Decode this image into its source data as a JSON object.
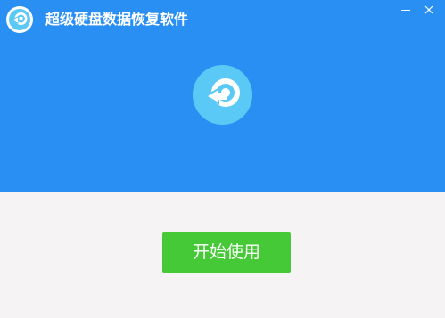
{
  "window": {
    "title": "超级硬盘数据恢复软件",
    "icon": "data-recovery-icon",
    "controls": {
      "minimize_icon": "minimize-icon",
      "close_icon": "close-icon"
    }
  },
  "main": {
    "logo_icon": "data-recovery-icon",
    "start_button_label": "开始使用"
  },
  "colors": {
    "header_bg": "#2a8ff2",
    "body_bg": "#f5f3f4",
    "icon_circle": "#5bc9f5",
    "button_bg": "#46c936",
    "text_on_accent": "#ffffff"
  }
}
